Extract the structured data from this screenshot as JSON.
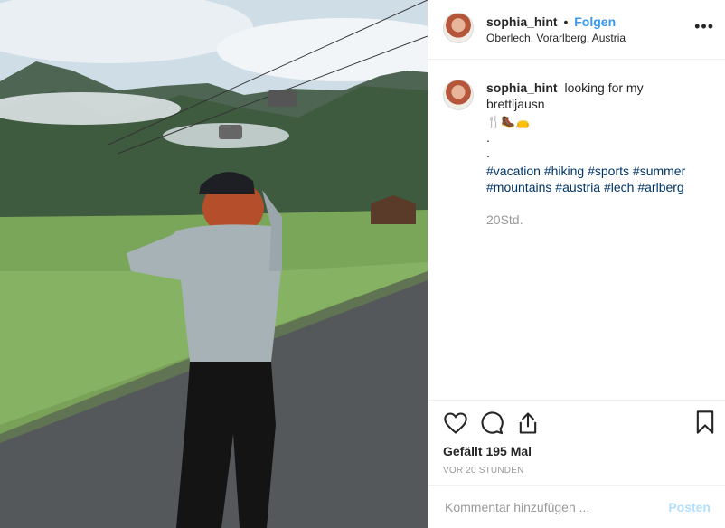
{
  "header": {
    "username": "sophia_hint",
    "separator": "•",
    "follow_label": "Folgen",
    "location": "Oberlech, Vorarlberg, Austria",
    "more_label": "•••"
  },
  "caption": {
    "username": "sophia_hint",
    "text": "looking for my brettljausn",
    "emojis": "🍴🥾👝",
    "dot1": ".",
    "dot2": ".",
    "hashtags": [
      "#vacation",
      "#hiking",
      "#sports",
      "#summer",
      "#mountains",
      "#austria",
      "#lech",
      "#arlberg"
    ],
    "time": "20Std."
  },
  "actions": {
    "like_icon": "heart-icon",
    "comment_icon": "comment-icon",
    "share_icon": "share-icon",
    "save_icon": "bookmark-icon",
    "likes_text": "Gefällt 195 Mal",
    "posted_ago": "VOR 20 STUNDEN"
  },
  "comment_box": {
    "placeholder": "Kommentar hinzufügen ...",
    "post_label": "Posten"
  },
  "colors": {
    "link_blue": "#3897f0",
    "hashtag_blue": "#003569",
    "muted": "#999999",
    "post_disabled": "#b2dffc"
  }
}
